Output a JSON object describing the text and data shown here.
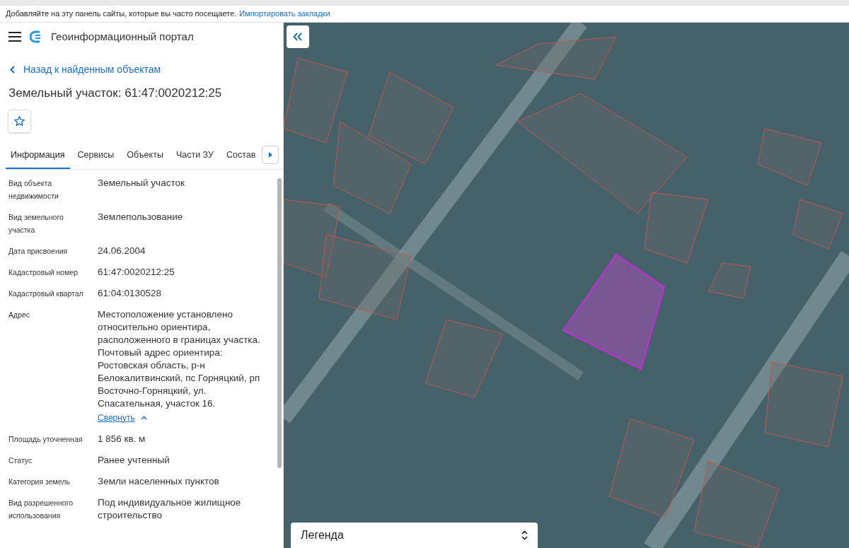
{
  "bookmarks_bar": {
    "message": "Добавляйте на эту панель сайты, которые вы часто посещаете.",
    "link": "Импортировать закладки"
  },
  "header": {
    "title": "Геоинформационный портал"
  },
  "back_link": "Назад к найденным объектам",
  "object_title": "Земельный участок: 61:47:0020212:25",
  "favorite": {
    "on": false
  },
  "tabs": [
    {
      "label": "Информация",
      "selected": true
    },
    {
      "label": "Сервисы",
      "selected": false
    },
    {
      "label": "Объекты",
      "selected": false
    },
    {
      "label": "Части ЗУ",
      "selected": false
    },
    {
      "label": "Состав",
      "selected": false
    }
  ],
  "fields": [
    {
      "label": "Вид объекта недвижимости",
      "value": "Земельный участок"
    },
    {
      "label": "Вид земельного участка",
      "value": "Землепользование"
    },
    {
      "label": "Дата присвоения",
      "value": "24.06.2004"
    },
    {
      "label": "Кадастровый номер",
      "value": "61:47:0020212:25"
    },
    {
      "label": "Кадастровый квартал",
      "value": "61:04:0130528"
    },
    {
      "label": "Адрес",
      "value": "Местоположение установлено относительно ориентира, расположенного в границах участка. Почтовый адрес ориентира: Ростовская область, р-н Белокалитвинский, пс Горняцкий, рп Восточно-Горняцкий, ул. Спасательная, участок 16.",
      "collapse_link": "Свернуть"
    },
    {
      "label": "Площадь уточненная",
      "value": "1 856 кв. м"
    },
    {
      "label": "Статус",
      "value": "Ранее учтенный"
    },
    {
      "label": "Категория земель",
      "value": "Земли населенных пунктов"
    },
    {
      "label": "Вид разрешенного использования",
      "value": "Под индивидуальное жилищное строительство"
    }
  ],
  "map": {
    "legend": {
      "title": "Легенда"
    }
  }
}
